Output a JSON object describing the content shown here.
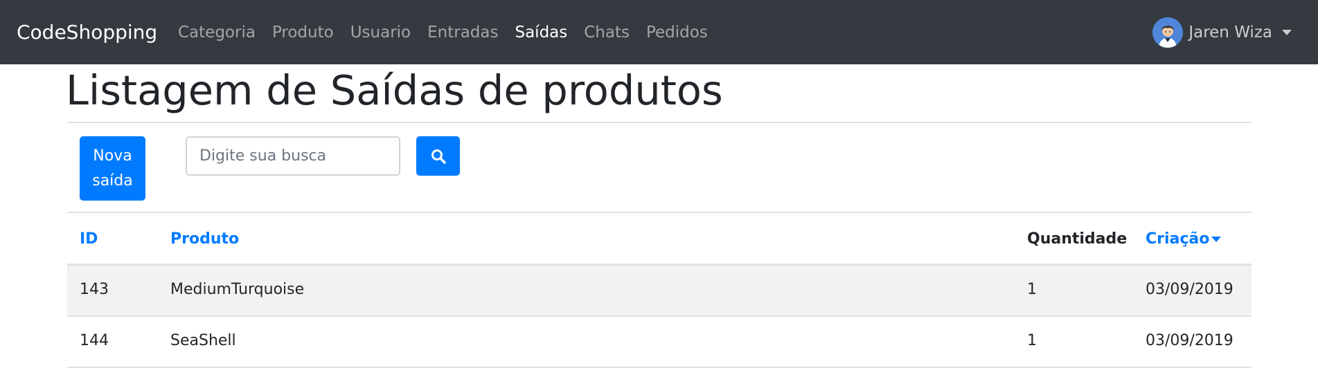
{
  "navbar": {
    "brand": "CodeShopping",
    "links": [
      {
        "label": "Categoria",
        "active": false
      },
      {
        "label": "Produto",
        "active": false
      },
      {
        "label": "Usuario",
        "active": false
      },
      {
        "label": "Entradas",
        "active": false
      },
      {
        "label": "Saídas",
        "active": true
      },
      {
        "label": "Chats",
        "active": false
      },
      {
        "label": "Pedidos",
        "active": false
      }
    ],
    "user": {
      "name": "Jaren Wiza",
      "avatar_icon": "user-avatar-icon"
    },
    "background": "#343a40"
  },
  "page": {
    "title": "Listagem de Saídas de produtos"
  },
  "toolbar": {
    "new_button_label": "Nova saída",
    "search_placeholder": "Digite sua busca",
    "search_value": "",
    "search_icon": "search-icon",
    "accent": "#007bff"
  },
  "table": {
    "headers": {
      "id": "ID",
      "produto": "Produto",
      "quantidade": "Quantidade",
      "criacao": "Criação"
    },
    "sort": {
      "column": "Criação",
      "direction": "desc"
    },
    "rows": [
      {
        "id": "143",
        "produto": "MediumTurquoise",
        "quantidade": "1",
        "criacao": "03/09/2019"
      },
      {
        "id": "144",
        "produto": "SeaShell",
        "quantidade": "1",
        "criacao": "03/09/2019"
      }
    ]
  }
}
